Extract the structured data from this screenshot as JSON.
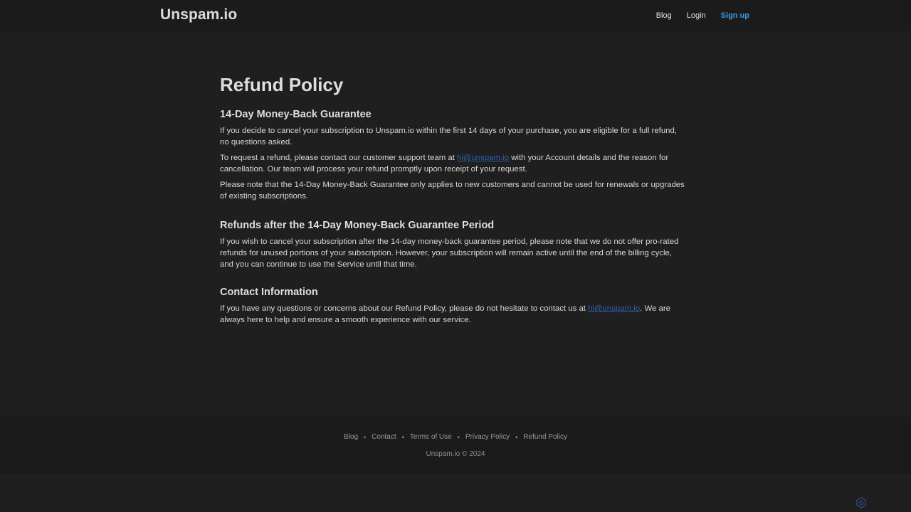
{
  "header": {
    "logo": "Unspam.io",
    "nav": {
      "blog": "Blog",
      "login": "Login",
      "signup": "Sign up"
    }
  },
  "main": {
    "title": "Refund Policy",
    "sections": [
      {
        "heading": "14-Day Money-Back Guarantee",
        "p1": "If you decide to cancel your subscription to Unspam.io within the first 14 days of your purchase, you are eligible for a full refund, no questions asked.",
        "p2_before": "To request a refund, please contact our customer support team at ",
        "p2_email": "hi@unspam.io",
        "p2_after": " with your Account details and the reason for cancellation. Our team will process your refund promptly upon receipt of your request.",
        "p3": "Please note that the 14-Day Money-Back Guarantee only applies to new customers and cannot be used for renewals or upgrades of existing subscriptions."
      },
      {
        "heading": "Refunds after the 14-Day Money-Back Guarantee Period",
        "p1": "If you wish to cancel your subscription after the 14-day money-back guarantee period, please note that we do not offer pro-rated refunds for unused portions of your subscription. However, your subscription will remain active until the end of the billing cycle, and you can continue to use the Service until that time."
      },
      {
        "heading": "Contact Information",
        "p1_before": "If you have any questions or concerns about our Refund Policy, please do not hesitate to contact us at ",
        "p1_email": "hi@unspam.io",
        "p1_after": ". We are always here to help and ensure a smooth experience with our service."
      }
    ]
  },
  "footer": {
    "links": [
      "Blog",
      "Contact",
      "Terms of Use",
      "Privacy Policy",
      "Refund Policy"
    ],
    "separator": "•",
    "copyright": "Unspam.io © 2024"
  },
  "colors": {
    "background": "#1f1f1f",
    "header_background": "#1b1b1b",
    "accent": "#3b9be8",
    "link": "#2f5fb0"
  },
  "icons": {
    "floating_widget": "gear-widget-icon"
  }
}
